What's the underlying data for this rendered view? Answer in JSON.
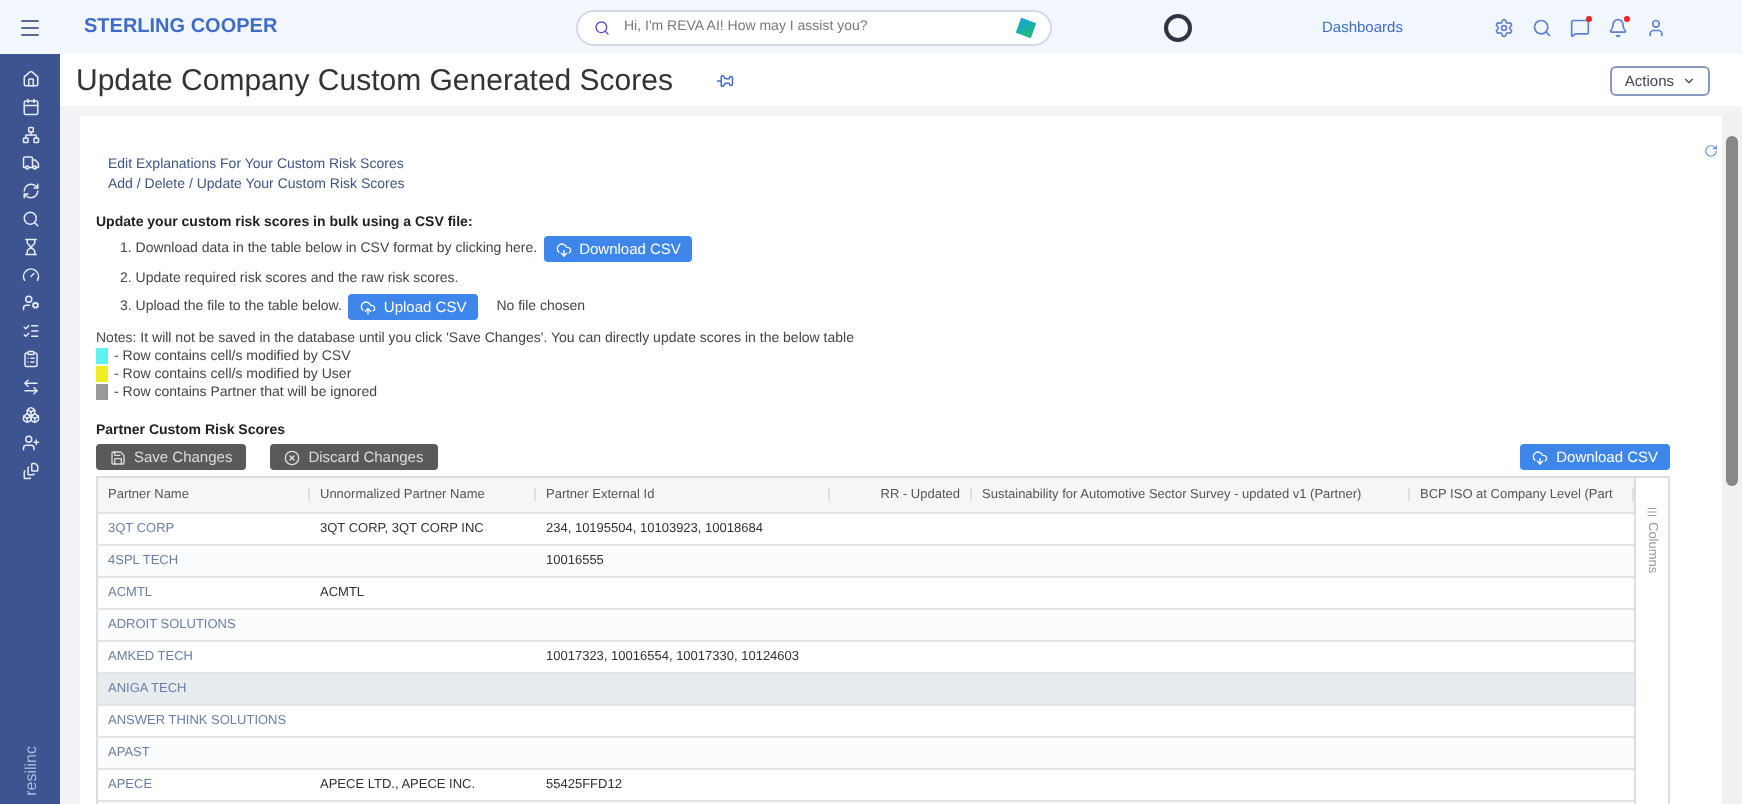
{
  "header": {
    "brand": "STERLING COOPER",
    "search": {
      "placeholder": "Hi, I'm REVA AI! How may I assist you?"
    },
    "nav_link": "Dashboards",
    "notifications": {
      "messages": true,
      "alerts": true
    }
  },
  "sidebar": {
    "footer": "resilinc"
  },
  "page": {
    "title": "Update Company Custom Generated Scores",
    "actions": "Actions"
  },
  "links": [
    "Edit Explanations For Your Custom Risk Scores",
    "Add / Delete / Update Your Custom Risk Scores"
  ],
  "bulk": {
    "heading": "Update your custom risk scores in bulk using a CSV file:",
    "steps": [
      {
        "text": "1. Download data in the table below in CSV format by clicking here.",
        "kind": "download",
        "button": "Download CSV"
      },
      {
        "text": "2. Update required risk scores and the raw risk scores.",
        "kind": "plain"
      },
      {
        "text": "3. Upload the file to the table below.",
        "kind": "upload",
        "button": "Upload CSV",
        "status": "No file chosen"
      }
    ]
  },
  "notes": "Notes: It will not be saved in the database until you click 'Save Changes'. You can directly update scores in the below table",
  "legend": [
    {
      "text": "- Row contains cell/s modified by CSV",
      "color": "#5ef2f2"
    },
    {
      "text": "- Row contains cell/s modified by User",
      "color": "#eeee22"
    },
    {
      "text": "- Row contains Partner that will be ignored",
      "color": "#999999"
    }
  ],
  "table": {
    "title": "Partner Custom Risk Scores",
    "save": "Save Changes",
    "discard": "Discard Changes",
    "download": "Download CSV",
    "columns_tab": "Columns",
    "columns": [
      "Partner Name",
      "Unnormalized Partner Name",
      "Partner External Id",
      "RR - Updated",
      "Sustainability for Automotive Sector Survey - updated v1 (Partner)",
      "BCP ISO at Company Level (Part"
    ],
    "rows": [
      {
        "cells": [
          "3QT CORP",
          "3QT CORP, 3QT CORP INC",
          "234, 10195504, 10103923, 10018684"
        ],
        "selected": false
      },
      {
        "cells": [
          "4SPL TECH",
          "",
          "10016555"
        ],
        "selected": false
      },
      {
        "cells": [
          "ACMTL",
          "ACMTL",
          ""
        ],
        "selected": false
      },
      {
        "cells": [
          "ADROIT SOLUTIONS",
          "",
          ""
        ],
        "selected": false
      },
      {
        "cells": [
          "AMKED TECH",
          "",
          "10017323, 10016554, 10017330, 10124603"
        ],
        "selected": false
      },
      {
        "cells": [
          "ANIGA TECH",
          "",
          ""
        ],
        "selected": true
      },
      {
        "cells": [
          "ANSWER THINK SOLUTIONS",
          "",
          ""
        ],
        "selected": false
      },
      {
        "cells": [
          "APAST",
          "",
          ""
        ],
        "selected": false
      },
      {
        "cells": [
          "APECE",
          "APECE LTD., APECE INC.",
          "55425FFD12"
        ],
        "selected": false
      }
    ]
  }
}
